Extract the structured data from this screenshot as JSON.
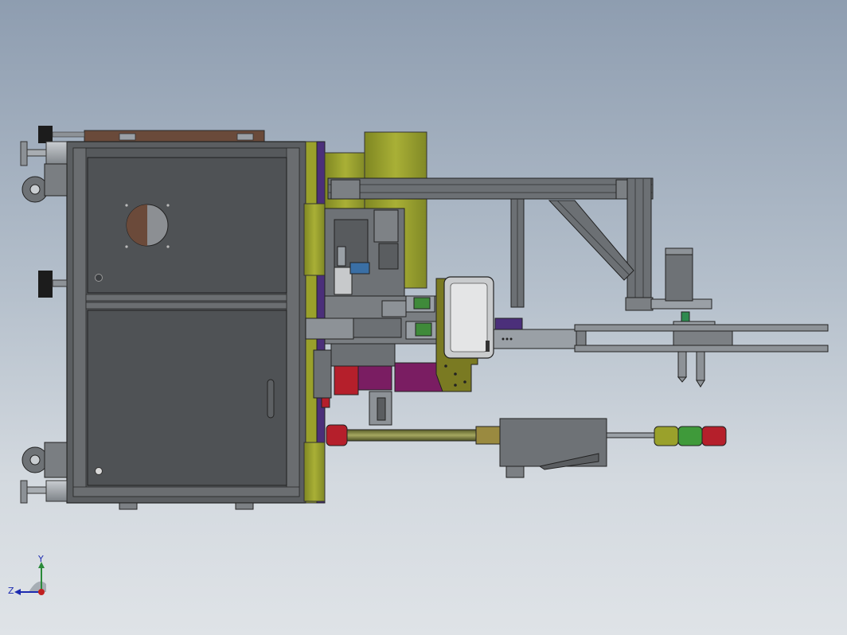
{
  "window": {
    "title": ""
  },
  "viewport": {
    "background_top": "#8e9db0",
    "background_bottom": "#dfe3e7",
    "model_colors": {
      "frame": "#5a5d60",
      "panel": "#4f5255",
      "olive": "#9aa12b",
      "purple": "#4b2f7a",
      "magenta": "#7a1d62",
      "red": "#b51f2b",
      "green": "#3f9a3a",
      "steel": "#9aa0a6"
    }
  },
  "triad": {
    "x_label": "",
    "y_label": "Y",
    "z_label": "Z",
    "icon": "coordinate-triad-icon"
  }
}
